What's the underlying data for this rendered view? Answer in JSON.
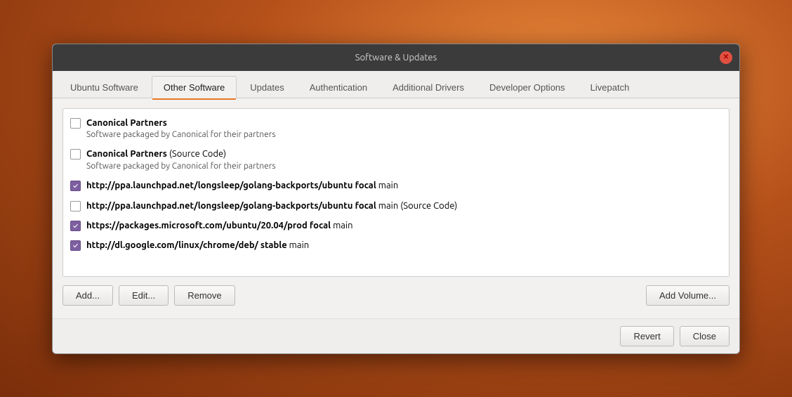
{
  "dialog": {
    "title": "Software & Updates"
  },
  "tabs": [
    {
      "id": "ubuntu-software",
      "label": "Ubuntu Software",
      "active": false
    },
    {
      "id": "other-software",
      "label": "Other Software",
      "active": true
    },
    {
      "id": "updates",
      "label": "Updates",
      "active": false
    },
    {
      "id": "authentication",
      "label": "Authentication",
      "active": false
    },
    {
      "id": "additional-drivers",
      "label": "Additional Drivers",
      "active": false
    },
    {
      "id": "developer-options",
      "label": "Developer Options",
      "active": false
    },
    {
      "id": "livepatch",
      "label": "Livepatch",
      "active": false
    }
  ],
  "repo_items": [
    {
      "id": "canonical-partners",
      "checked": false,
      "name": "Canonical Partners",
      "name_suffix": "",
      "desc": "Software packaged by Canonical for their partners",
      "url": "",
      "url_suffix": ""
    },
    {
      "id": "canonical-partners-source",
      "checked": false,
      "name": "Canonical Partners",
      "name_suffix": " (Source Code)",
      "desc": "Software packaged by Canonical for their partners",
      "url": "",
      "url_suffix": ""
    },
    {
      "id": "golang-backports",
      "checked": true,
      "name": "",
      "name_suffix": "",
      "desc": "",
      "url": "http://ppa.launchpad.net/longsleep/golang-backports/ubuntu focal",
      "url_suffix": " main"
    },
    {
      "id": "golang-backports-source",
      "checked": false,
      "name": "",
      "name_suffix": "",
      "desc": "",
      "url": "http://ppa.launchpad.net/longsleep/golang-backports/ubuntu focal",
      "url_suffix": " main (Source Code)"
    },
    {
      "id": "microsoft-prod",
      "checked": true,
      "name": "",
      "name_suffix": "",
      "desc": "",
      "url": "https://packages.microsoft.com/ubuntu/20.04/prod focal",
      "url_suffix": " main"
    },
    {
      "id": "google-chrome",
      "checked": true,
      "name": "",
      "name_suffix": "",
      "desc": "",
      "url": "http://dl.google.com/linux/chrome/deb/ stable",
      "url_suffix": " main"
    }
  ],
  "buttons": {
    "add": "Add...",
    "edit": "Edit...",
    "remove": "Remove",
    "add_volume": "Add Volume...",
    "revert": "Revert",
    "close": "Close"
  }
}
